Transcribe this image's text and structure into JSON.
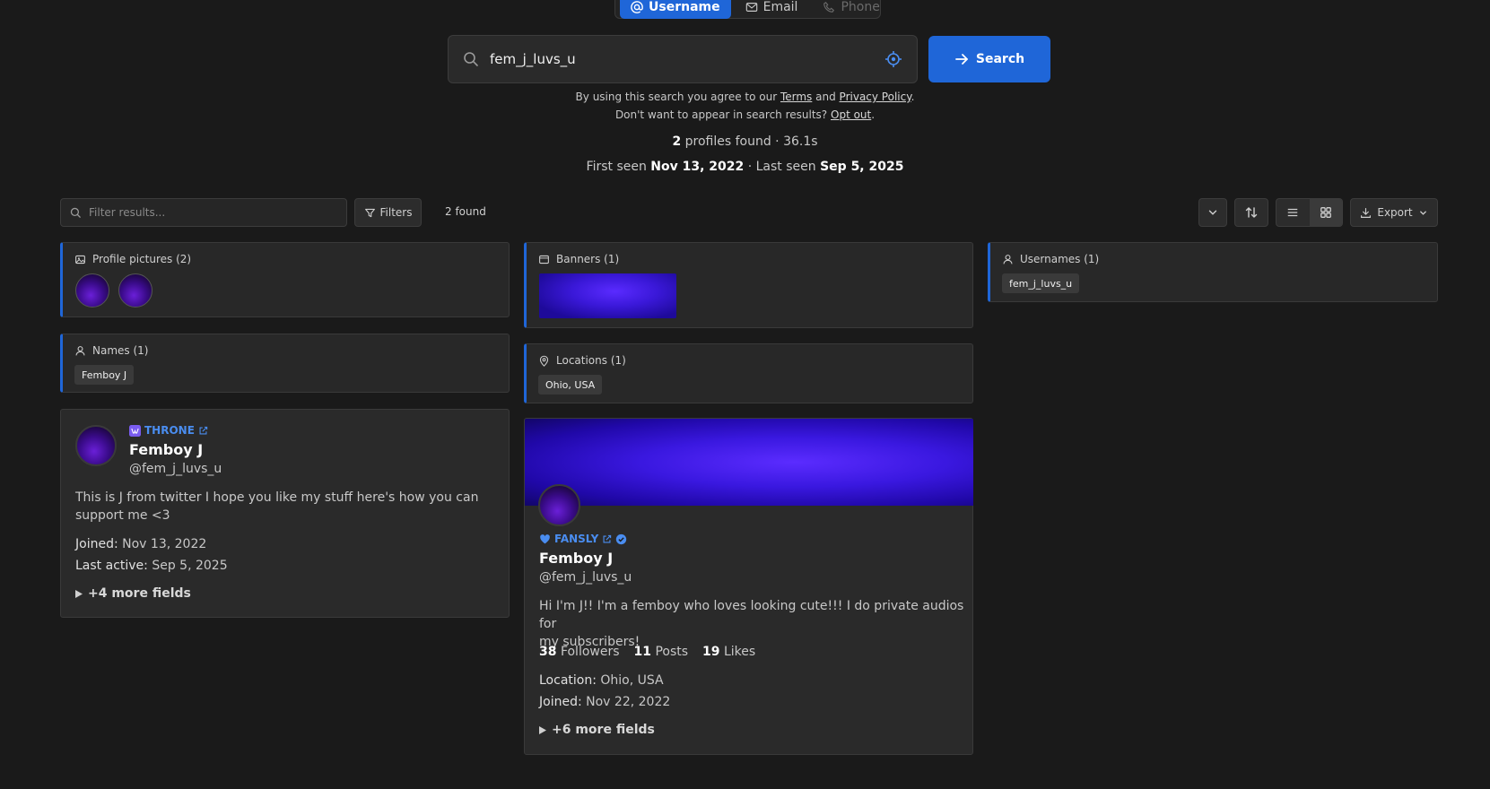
{
  "mode_tabs": [
    {
      "label": "Username",
      "icon": "at-icon",
      "active": true
    },
    {
      "label": "Email",
      "icon": "mail-icon",
      "active": false
    },
    {
      "label": "Phone",
      "icon": "phone-icon",
      "active": false
    }
  ],
  "search": {
    "value": "fem_j_luvs_u",
    "button_label": "Search"
  },
  "consent": {
    "line1_prefix": "By using this search you agree to our",
    "terms": "Terms",
    "and": "and",
    "privacy": "Privacy Policy",
    "line2_prefix": "Don't want to appear in search results?",
    "opt_out": "Opt out"
  },
  "stats": {
    "count": "2",
    "found_text": "profiles found · 36.1s",
    "first_seen_label": "First seen",
    "first_seen": "Nov 13, 2022",
    "last_seen_label": "· Last seen",
    "last_seen": "Sep 5, 2025"
  },
  "toolbar": {
    "filter_placeholder": "Filter results...",
    "filters_label": "Filters",
    "found": "2 found",
    "export_label": "Export"
  },
  "panels": {
    "profile_pictures": "Profile pictures (2)",
    "names": "Names (1)",
    "names_chip": "Femboy J",
    "banners": "Banners (1)",
    "locations": "Locations (1)",
    "locations_chip": "Ohio, USA",
    "usernames": "Usernames (1)",
    "usernames_chip": "fem_j_luvs_u"
  },
  "card_throne": {
    "platform": "THRONE",
    "name": "Femboy J",
    "handle": "@fem_j_luvs_u",
    "bio_line1": "This is J from twitter I hope you like my stuff here's how you can",
    "bio_line2": "support me <3",
    "joined_label": "Joined:",
    "joined": "Nov 13, 2022",
    "active_label": "Last active:",
    "active": "Sep 5, 2025",
    "more": "+4 more fields"
  },
  "card_fansly": {
    "platform": "FANSLY",
    "name": "Femboy J",
    "handle": "@fem_j_luvs_u",
    "bio_line1": "Hi I'm J!! I'm a femboy who loves looking cute!!! I do private audios for",
    "bio_line2": "my subscribers!",
    "followers": "38",
    "followers_label": "Followers",
    "posts": "11",
    "posts_label": "Posts",
    "likes": "19",
    "likes_label": "Likes",
    "location_label": "Location:",
    "location": "Ohio, USA",
    "joined_label": "Joined:",
    "joined": "Nov 22, 2022",
    "more": "+6 more fields"
  },
  "colors": {
    "background": "#1a1a1a",
    "accent": "#1f66d8",
    "link": "#4a8df0"
  }
}
